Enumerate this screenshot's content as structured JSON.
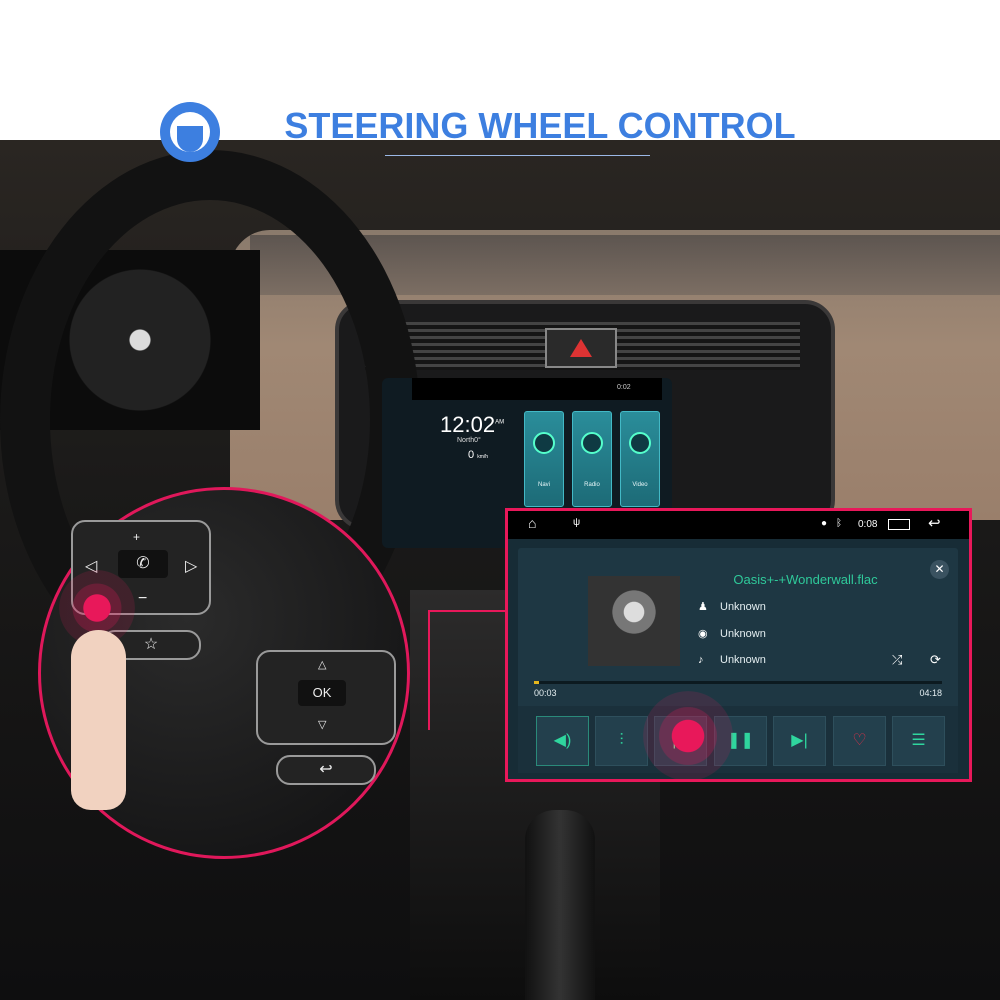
{
  "header": {
    "title": "STEERING WHEEL CONTROL",
    "accent_color": "#3d7fe0",
    "icon": "steering-wheel-icon"
  },
  "highlight_color": "#e8185a",
  "steering_buttons": {
    "left": [
      "+",
      "◁",
      "phone",
      "▷",
      "−",
      "☆"
    ],
    "right_ok": "OK",
    "right": [
      "△",
      "▽",
      "back"
    ]
  },
  "head_unit": {
    "status_time": "0:02",
    "clock": "12:02",
    "ampm": "AM",
    "heading": "North0°",
    "speed": "0",
    "speed_unit": "km/h",
    "tiles": [
      "Navi",
      "Radio",
      "Video"
    ]
  },
  "player": {
    "status": {
      "time": "0:08",
      "icons": [
        "home-icon",
        "usb-icon",
        "location-icon",
        "bluetooth-icon",
        "recent-apps-icon",
        "back-icon"
      ]
    },
    "track": "Oasis+-+Wonderwall.flac",
    "artist": "Unknown",
    "album": "Unknown",
    "genre": "Unknown",
    "elapsed": "00:03",
    "duration": "04:18",
    "progress_pct": 1.2,
    "controls": [
      "volume",
      "equalizer",
      "previous",
      "play-pause",
      "next",
      "favorite",
      "playlist"
    ]
  }
}
